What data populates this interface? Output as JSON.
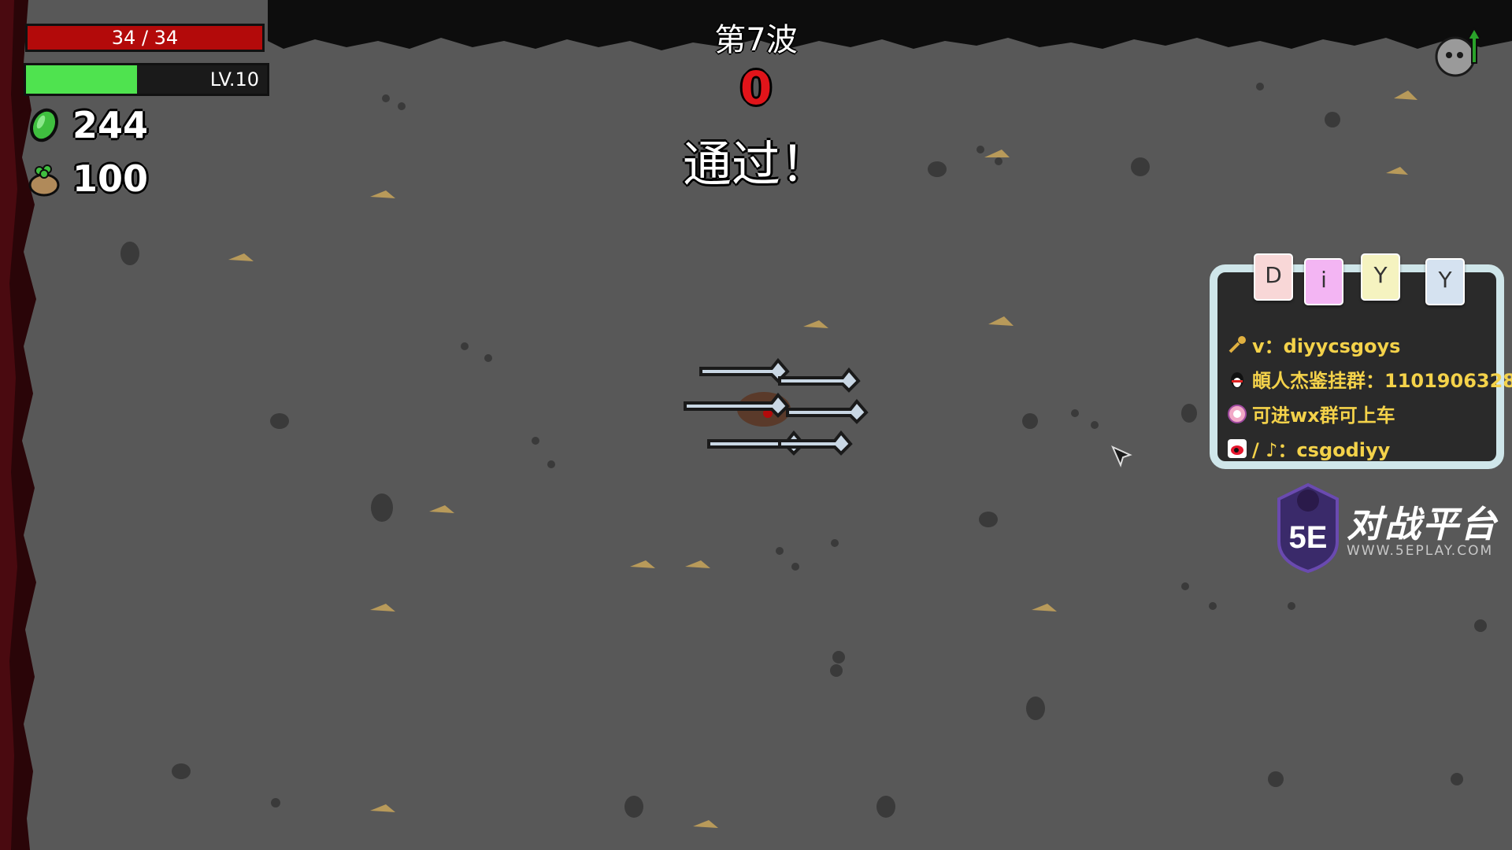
{
  "hud": {
    "hp": {
      "current": 34,
      "max": 34,
      "text": "34 / 34"
    },
    "level": {
      "text": "LV.10",
      "xp_fraction": 0.46
    },
    "materials": "244",
    "bag": "100"
  },
  "wave": {
    "title": "第7波",
    "timer": "0",
    "status": "通过！"
  },
  "stream_overlay": {
    "tags": [
      "D",
      "i",
      "Y",
      "Y"
    ],
    "lines": [
      {
        "icon": "key-icon",
        "text": "v：diyycsgoys"
      },
      {
        "icon": "qq-penguin-icon",
        "text": "頔人杰鉴挂群：1101906328"
      },
      {
        "icon": "wechat-badge-icon",
        "text": "可进wx群可上车"
      },
      {
        "icon": "weibo-douyin-icon",
        "text": "/ ♪：csgodiyy"
      }
    ],
    "brand_title": "对战平台",
    "brand_url": "WWW.5EPLAY.COM",
    "brand_logo_text": "5E"
  },
  "colors": {
    "ground": "#585858",
    "hp": "#b30a0a",
    "xp": "#4fe34f",
    "timer": "#e1141a",
    "overlay_text": "#f4d24a"
  }
}
